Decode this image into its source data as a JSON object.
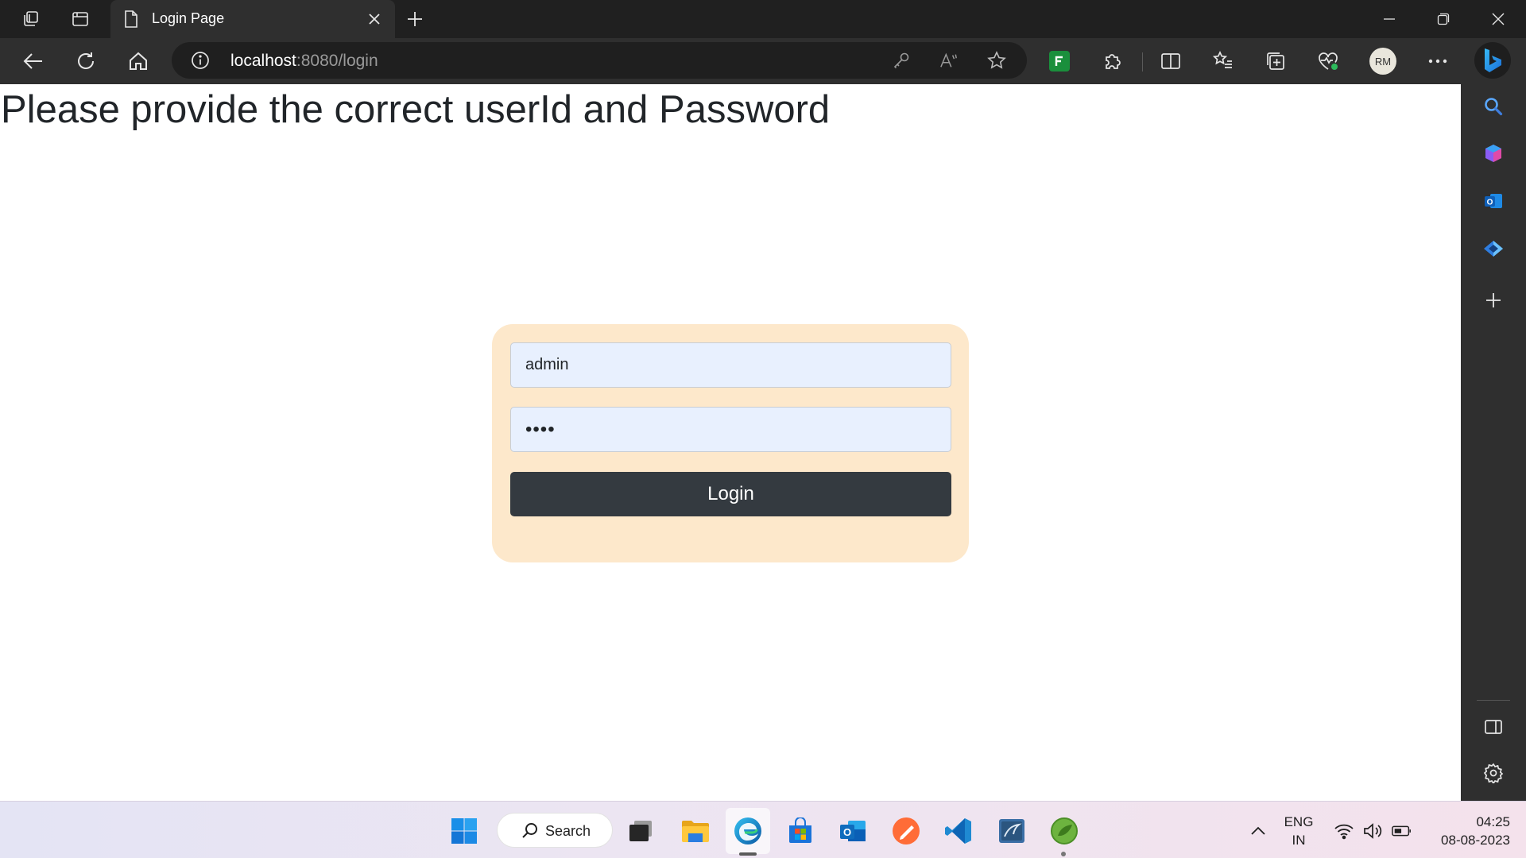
{
  "browser": {
    "tab_title": "Login Page",
    "address_host": "localhost",
    "address_path": ":8080/login",
    "profile_initials": "RM"
  },
  "page": {
    "heading": "Please provide the correct userId and Password",
    "form": {
      "username_value": "admin",
      "password_value": "••••",
      "login_label": "Login"
    }
  },
  "taskbar": {
    "search_label": "Search",
    "lang_line1": "ENG",
    "lang_line2": "IN",
    "time": "04:25",
    "date": "08-08-2023"
  },
  "colors": {
    "card_bg": "#fde8cb",
    "input_bg": "#e8f0fe",
    "button_bg": "#343a40",
    "browser_chrome": "#2f2f2f",
    "titlebar": "#202020"
  }
}
